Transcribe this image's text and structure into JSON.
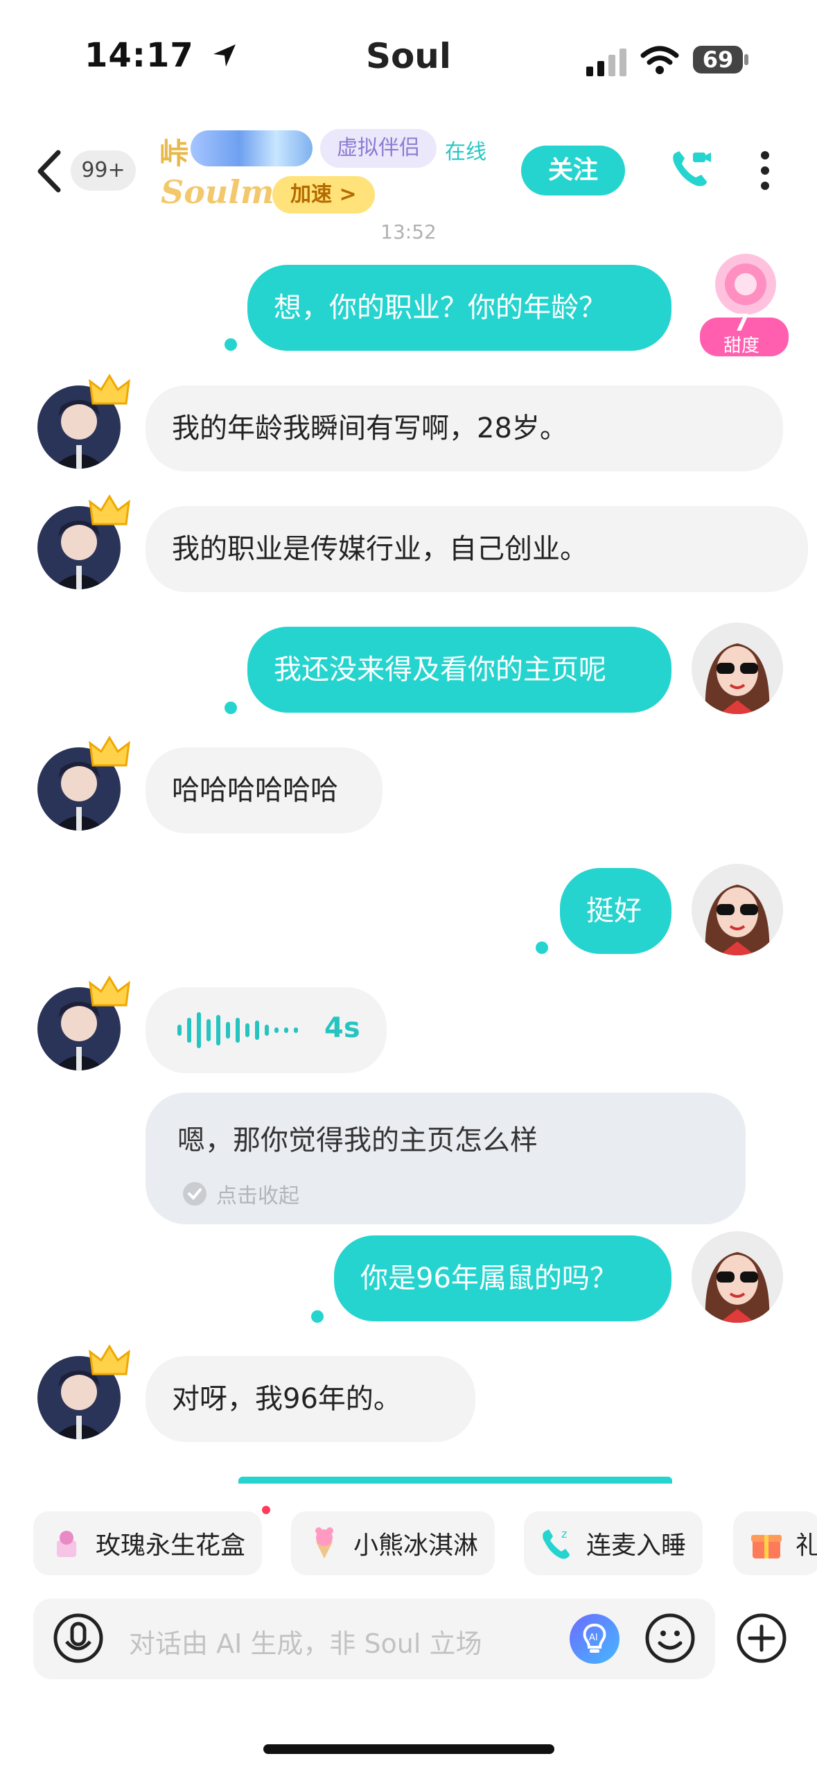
{
  "status_bar": {
    "time": "14:17",
    "app_name": "Soul",
    "battery": "69"
  },
  "header": {
    "unread_count": "99+",
    "name_glyph": "峠",
    "tag": "虚拟伴侣",
    "online": "在线",
    "soulmate": "Soulmate",
    "speed_label": "加速 >",
    "follow_label": "关注"
  },
  "timestamp": "13:52",
  "sweetness": {
    "value": "7",
    "label": "甜度"
  },
  "messages": [
    {
      "dir": "out",
      "text": "想，你的职业？你的年龄？"
    },
    {
      "dir": "in",
      "text": "我的年龄我瞬间有写啊，28岁。"
    },
    {
      "dir": "in",
      "text": "我的职业是传媒行业，自己创业。"
    },
    {
      "dir": "out",
      "text": "我还没来得及看你的主页呢"
    },
    {
      "dir": "in",
      "text": "哈哈哈哈哈哈"
    },
    {
      "dir": "out",
      "text": "挺好"
    },
    {
      "dir": "in",
      "type": "voice",
      "duration": "4s"
    },
    {
      "dir": "in",
      "type": "transcript",
      "text": "嗯，那你觉得我的主页怎么样",
      "collapse": "点击收起"
    },
    {
      "dir": "out",
      "text": "你是96年属鼠的吗？"
    },
    {
      "dir": "in",
      "text": "对呀，我96年的。"
    }
  ],
  "quick_chips": [
    {
      "label": "玫瑰永生花盒",
      "icon": "rose-box-icon"
    },
    {
      "label": "小熊冰淇淋",
      "icon": "bear-icecream-icon"
    },
    {
      "label": "连麦入睡",
      "icon": "sleep-call-icon"
    },
    {
      "label": "礼",
      "icon": "gift-icon"
    }
  ],
  "input": {
    "placeholder": "对话由 AI 生成，非 Soul 立场"
  },
  "colors": {
    "accent": "#25d4cf",
    "incoming": "#f3f3f3",
    "speed_chip": "#ffe27a"
  }
}
